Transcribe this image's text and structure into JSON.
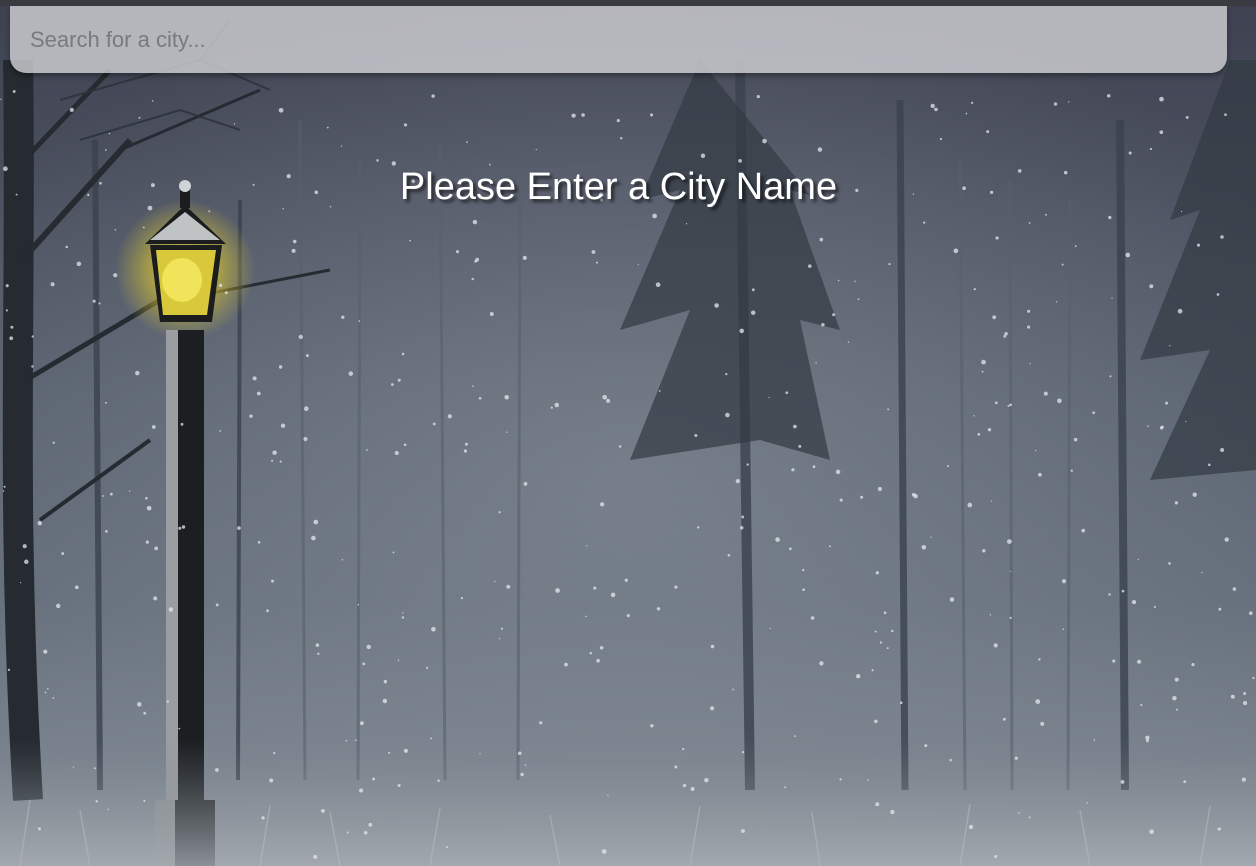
{
  "search": {
    "placeholder": "Search for a city...",
    "value": ""
  },
  "message": "Please Enter a City Name",
  "background": {
    "description_icon": "snowy-forest-lamppost",
    "lamp_glow_color": "#f2e04a"
  }
}
